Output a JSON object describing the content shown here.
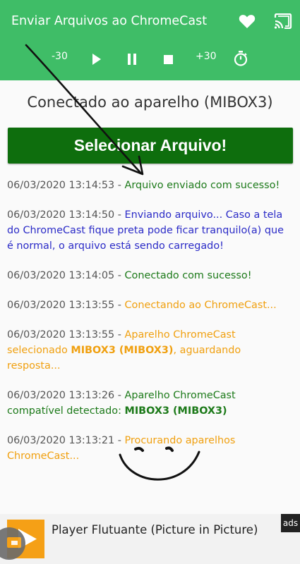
{
  "appbar": {
    "title": "Enviar Arquivos ao ChromeCast",
    "favorite_icon": "heart-icon",
    "cast_icon": "cast-icon",
    "color": "#3fbd67"
  },
  "controls": {
    "rewind_label": "-30",
    "forward_label": "+30"
  },
  "status": {
    "connected_text": "Conectado ao aparelho (MIBOX3)"
  },
  "select_button": {
    "label": "Selecionar Arquivo!",
    "color": "#0e6e0d"
  },
  "log": [
    {
      "ts": "06/03/2020 13:14:53",
      "sep": " - ",
      "msg": "Arquivo enviado com sucesso!"
    },
    {
      "ts": "06/03/2020 13:14:50",
      "sep": " - ",
      "msg": "Enviando arquivo... Caso a tela do ChromeCast fique preta pode ficar tranquilo(a) que é normal, o arquivo está sendo carregado!"
    },
    {
      "ts": "06/03/2020 13:14:05",
      "sep": " - ",
      "msg": "Conectado com sucesso!"
    },
    {
      "ts": "06/03/2020 13:13:55",
      "sep": " - ",
      "msg": "Conectando ao ChromeCast..."
    },
    {
      "ts": "06/03/2020 13:13:55",
      "sep": " - ",
      "msg": "Aparelho ChromeCast selecionado ",
      "bold": "MIBOX3 (MIBOX3)",
      "msg2": ", aguardando resposta..."
    },
    {
      "ts": "06/03/2020 13:13:26",
      "sep": " - ",
      "msg": "Aparelho ChromeCast compatível detectado: ",
      "bold": "MIBOX3 (MIBOX3)"
    },
    {
      "ts": "06/03/2020 13:13:21",
      "sep": " - ",
      "msg": "Procurando aparelhos ChromeCast..."
    }
  ],
  "ad": {
    "title": "Player Flutuante (Picture in Picture)",
    "badge": "ads"
  }
}
